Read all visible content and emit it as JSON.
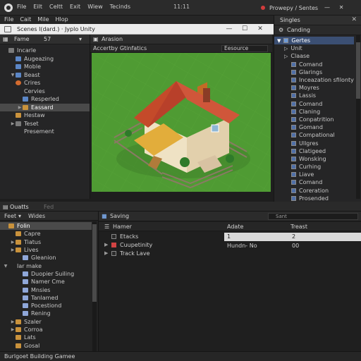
{
  "os": {
    "menu": [
      "File",
      "Eilt",
      "Celtt",
      "Exit",
      "Wiew",
      "Tecinds"
    ],
    "clock": "11:11",
    "right_label": "Prowepy / Sentes"
  },
  "app_menu": [
    "File",
    "Cait",
    "Mile",
    "Hlop"
  ],
  "window": {
    "title": "Scenes l(dard.) · Jyplo Unity"
  },
  "hierarchy": {
    "tabs": [
      "Fame",
      "57"
    ],
    "items": [
      {
        "label": "Incarle",
        "indent": 0,
        "arrow": "",
        "icon": "go"
      },
      {
        "label": "Augeazing",
        "indent": 1,
        "arrow": "",
        "icon": "cube"
      },
      {
        "label": "Moble",
        "indent": 1,
        "arrow": "",
        "icon": "cube"
      },
      {
        "label": "Beast",
        "indent": 1,
        "arrow": "▼",
        "icon": "cube"
      },
      {
        "label": "Crires",
        "indent": 1,
        "arrow": "",
        "icon": "orange"
      },
      {
        "label": "Cervies",
        "indent": 1,
        "arrow": "",
        "icon": "none"
      },
      {
        "label": "Resperled",
        "indent": 2,
        "arrow": "",
        "icon": "cube"
      },
      {
        "label": "Eassard",
        "indent": 2,
        "arrow": "▶",
        "icon": "folder",
        "selected": true
      },
      {
        "label": "Hestaw",
        "indent": 1,
        "arrow": "",
        "icon": "folder"
      },
      {
        "label": "Teset",
        "indent": 1,
        "arrow": "▶",
        "icon": "go"
      },
      {
        "label": "Presement",
        "indent": 1,
        "arrow": "",
        "icon": "none"
      }
    ]
  },
  "scene": {
    "tab": "Arasion",
    "toolbar_left": "Accertby Gtinfatics",
    "toolbar_right": "Eesource"
  },
  "inspector": {
    "title": "Singles",
    "header": "Canding",
    "items": [
      {
        "label": "Gertes",
        "selected": true,
        "kind": "head"
      },
      {
        "label": "Unit",
        "kind": "arrow"
      },
      {
        "label": "Claase",
        "kind": "arrow"
      },
      {
        "label": "Comand",
        "kind": "check"
      },
      {
        "label": "Glarings",
        "kind": "check"
      },
      {
        "label": "Inceazation sfilonty",
        "kind": "check"
      },
      {
        "label": "Moyres",
        "kind": "check"
      },
      {
        "label": "Lassis",
        "kind": "check"
      },
      {
        "label": "Comand",
        "kind": "check"
      },
      {
        "label": "Claning",
        "kind": "check"
      },
      {
        "label": "Conpatrition",
        "kind": "check"
      },
      {
        "label": "Gomand",
        "kind": "check"
      },
      {
        "label": "Compational",
        "kind": "check"
      },
      {
        "label": "Ullgres",
        "kind": "check"
      },
      {
        "label": "Clatigeed",
        "kind": "check"
      },
      {
        "label": "Wonsking",
        "kind": "check"
      },
      {
        "label": "Curhing",
        "kind": "check"
      },
      {
        "label": "Liave",
        "kind": "check"
      },
      {
        "label": "Comand",
        "kind": "check"
      },
      {
        "label": "Coreration",
        "kind": "check"
      },
      {
        "label": "Prosended",
        "kind": "check"
      }
    ]
  },
  "bottom": {
    "tabs": [
      "Ouatts",
      "Fed"
    ],
    "project_header": [
      "Feet",
      "Wides"
    ],
    "project_items": [
      {
        "label": "Folin",
        "indent": 0,
        "arrow": "",
        "selected": true,
        "icon": "folder"
      },
      {
        "label": "Capre",
        "indent": 1,
        "arrow": "",
        "icon": "folder"
      },
      {
        "label": "Tiatus",
        "indent": 1,
        "arrow": "▶",
        "icon": "folder"
      },
      {
        "label": "Lives",
        "indent": 1,
        "arrow": "▶",
        "icon": "folder"
      },
      {
        "label": "Gleanion",
        "indent": 2,
        "arrow": "",
        "icon": "script"
      },
      {
        "label": "Iar make",
        "indent": 0,
        "arrow": "▼",
        "icon": "none"
      },
      {
        "label": "Duopier Suiling",
        "indent": 2,
        "arrow": "",
        "icon": "script"
      },
      {
        "label": "Namer Cme",
        "indent": 2,
        "arrow": "",
        "icon": "script"
      },
      {
        "label": "Mnsies",
        "indent": 2,
        "arrow": "",
        "icon": "script"
      },
      {
        "label": "Tanlamed",
        "indent": 2,
        "arrow": "",
        "icon": "script"
      },
      {
        "label": "Pocestiond",
        "indent": 2,
        "arrow": "",
        "icon": "script"
      },
      {
        "label": "Rening",
        "indent": 2,
        "arrow": "",
        "icon": "script"
      },
      {
        "label": "Szaler",
        "indent": 1,
        "arrow": "▶",
        "icon": "folder"
      },
      {
        "label": "Corroa",
        "indent": 1,
        "arrow": "▶",
        "icon": "folder"
      },
      {
        "label": "Lats",
        "indent": 1,
        "arrow": "",
        "icon": "folder"
      },
      {
        "label": "Gosal",
        "indent": 1,
        "arrow": "",
        "icon": "folder"
      }
    ],
    "console": {
      "title": "Saving",
      "search_placeholder": "Sant",
      "columns": [
        "Hamer",
        "Adate",
        "Treast"
      ],
      "rows": [
        {
          "label": "Etacks",
          "checked": false,
          "arrow": ""
        },
        {
          "label": "Cuupetinity",
          "checked": true,
          "arrow": "▶"
        },
        {
          "label": "Track Lave",
          "checked": false,
          "arrow": "▶"
        }
      ],
      "detail_rows": [
        {
          "a": "1",
          "b": "2",
          "selected": true
        },
        {
          "a": "Hundn- No",
          "b": "00",
          "selected": false
        }
      ]
    },
    "status": "Burlgoet Building Gamee"
  }
}
